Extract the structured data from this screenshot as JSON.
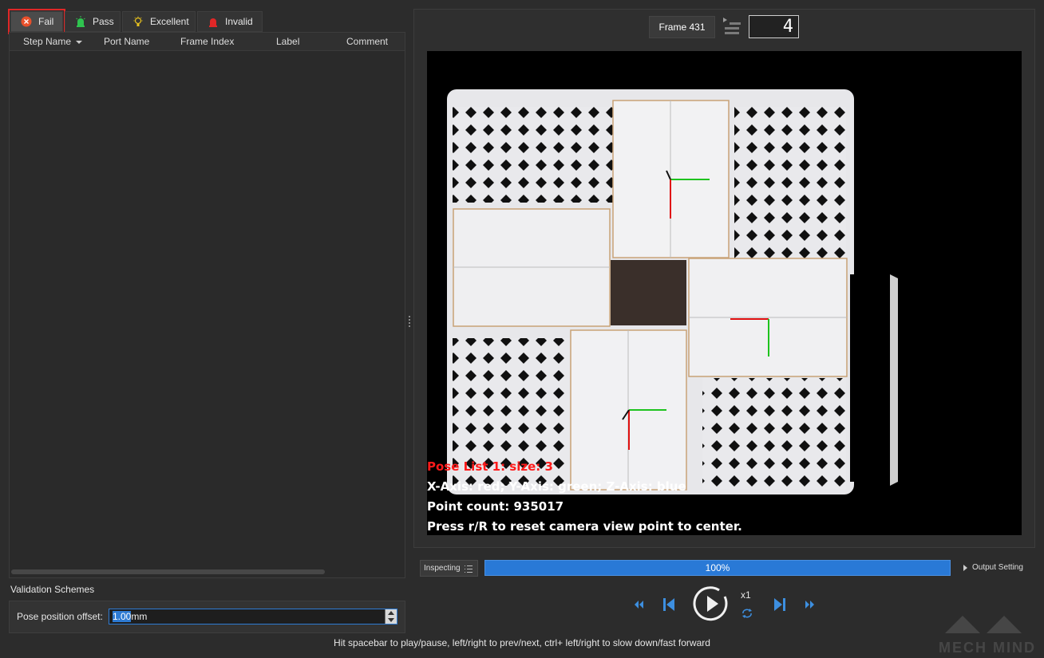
{
  "tabs": [
    {
      "label": "Fail",
      "icon": "fail-icon",
      "active": true
    },
    {
      "label": "Pass",
      "icon": "pass-icon"
    },
    {
      "label": "Excellent",
      "icon": "excellent-icon"
    },
    {
      "label": "Invalid",
      "icon": "invalid-icon"
    }
  ],
  "table": {
    "columns": [
      "Step Name",
      "Port Name",
      "Frame Index",
      "Label",
      "Comment"
    ],
    "rows": []
  },
  "validation": {
    "title": "Validation Schemes",
    "offset_label": "Pose position offset:",
    "offset_value": "1.00",
    "offset_unit": "mm"
  },
  "viewer": {
    "frame_label": "Frame 431",
    "frame_number": "4",
    "overlay_lines": [
      {
        "text": "Pose List 1: size: 3",
        "color": "#ff1a1a"
      },
      {
        "text": "X-Axis: red; Y-Axis: green; Z-Axis: blue",
        "color": "#ffffff"
      },
      {
        "text": "Point count: 935017",
        "color": "#ffffff"
      },
      {
        "text": "Press r/R to reset camera view point to center.",
        "color": "#ffffff"
      }
    ]
  },
  "playback": {
    "mode": "Inspecting",
    "progress_label": "100%",
    "progress": 1.0,
    "output_setting": "Output Setting",
    "speed": "x1",
    "hint": "Hit spacebar to play/pause, left/right to prev/next, ctrl+ left/right to slow down/fast forward"
  },
  "colors": {
    "accent": "#2979d6",
    "control_blue": "#3d8fe0",
    "fail_red": "#e02727",
    "pass_green": "#2fc34f",
    "excellent_yellow": "#e8c21e"
  },
  "watermark": "MECH MIND"
}
